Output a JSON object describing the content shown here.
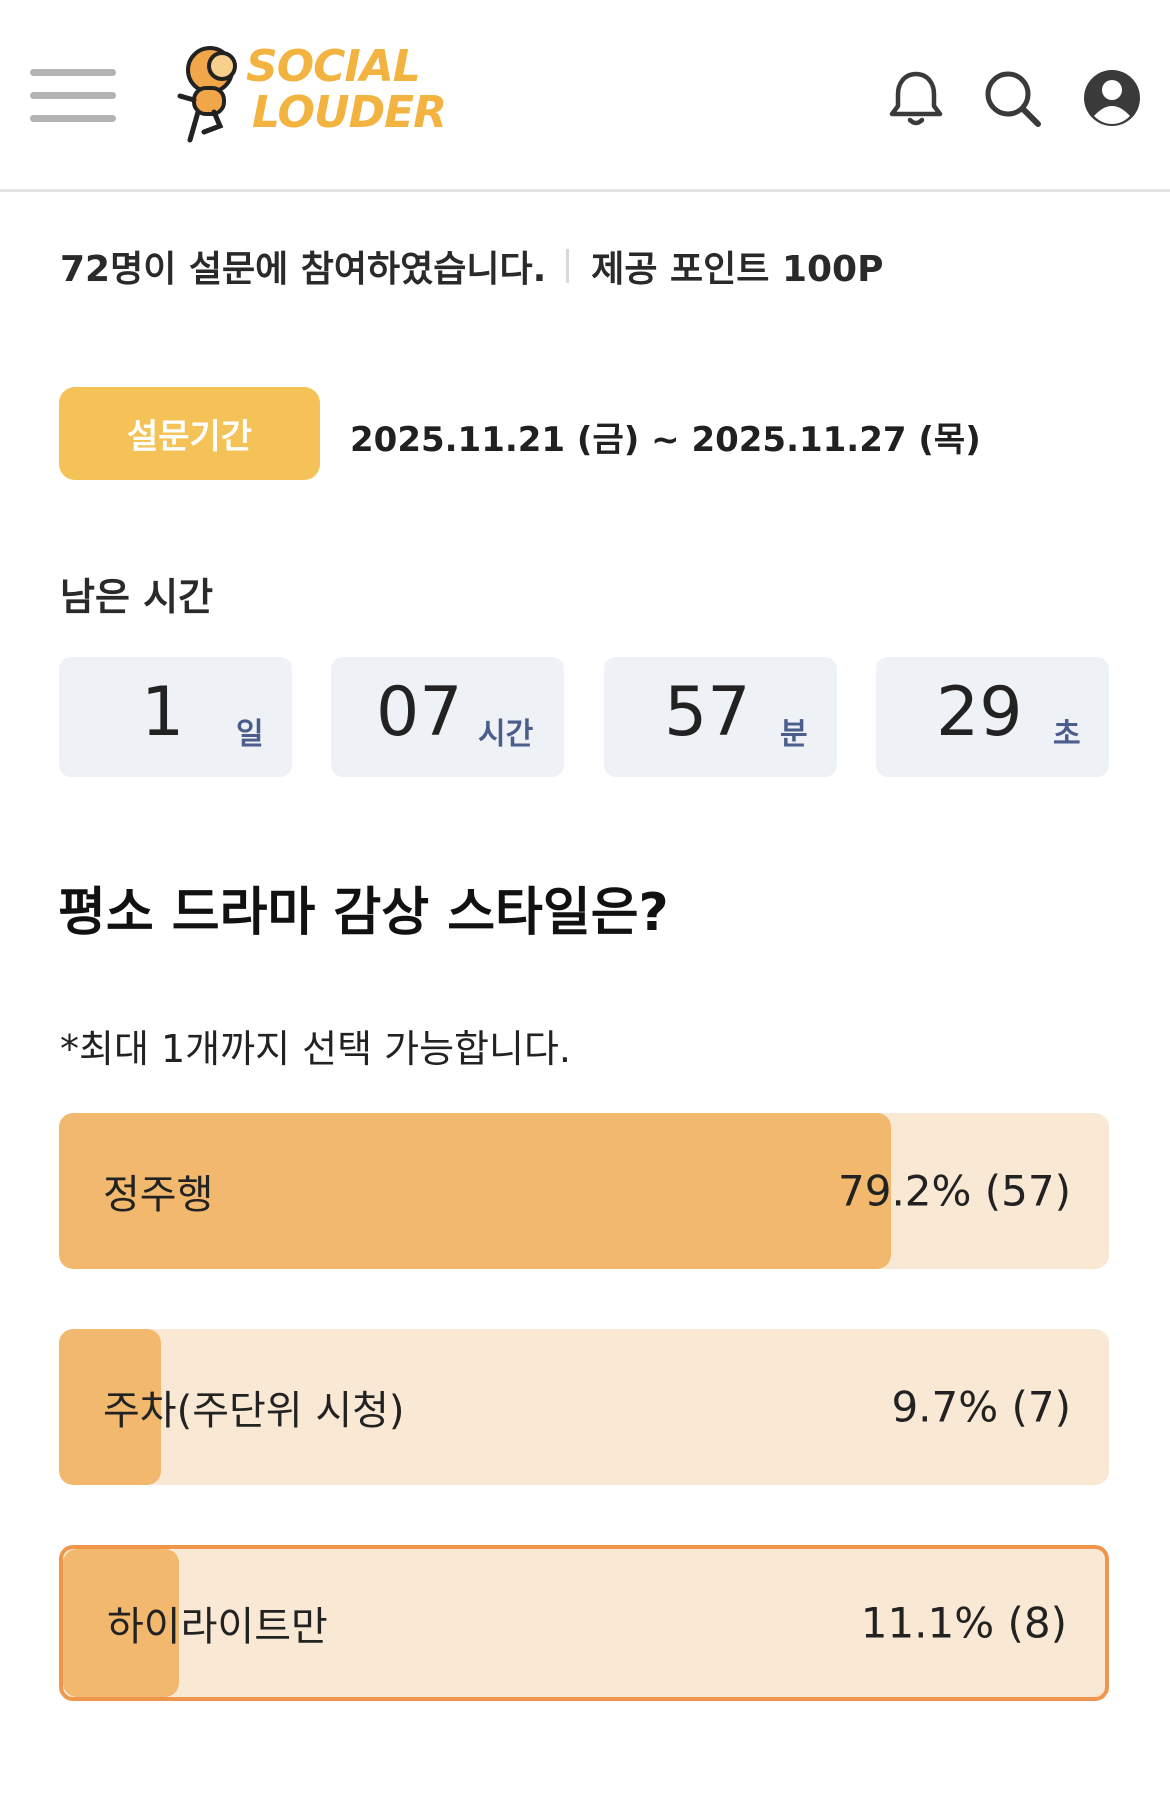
{
  "header": {
    "logo_line1": "SOCIAL",
    "logo_line2": "LOUDER"
  },
  "info": {
    "participants": "72명이 설문에 참여하였습니다.",
    "points": "제공 포인트 100P"
  },
  "period": {
    "label": "설문기간",
    "range": "2025.11.21 (금) ~ 2025.11.27 (목)"
  },
  "remaining": {
    "label": "남은 시간",
    "days": "1",
    "days_unit": "일",
    "hours": "07",
    "hours_unit": "시간",
    "minutes": "57",
    "minutes_unit": "분",
    "seconds": "29",
    "seconds_unit": "초"
  },
  "question": {
    "title": "평소 드라마 감상 스타일은?",
    "note": "*최대 1개까지 선택 가능합니다."
  },
  "options": [
    {
      "label": "정주행",
      "result": "79.2% (57)",
      "fraction": 0.792,
      "selected": false
    },
    {
      "label": "주차(주단위 시청)",
      "result": "9.7% (7)",
      "fraction": 0.097,
      "selected": false
    },
    {
      "label": "하이라이트만",
      "result": "11.1% (8)",
      "fraction": 0.111,
      "selected": true
    }
  ],
  "colors": {
    "accent": "#f4c257",
    "bar_fill": "#f2b86e",
    "bar_bg": "#f9e9d4",
    "selected_border": "#f0954c"
  }
}
